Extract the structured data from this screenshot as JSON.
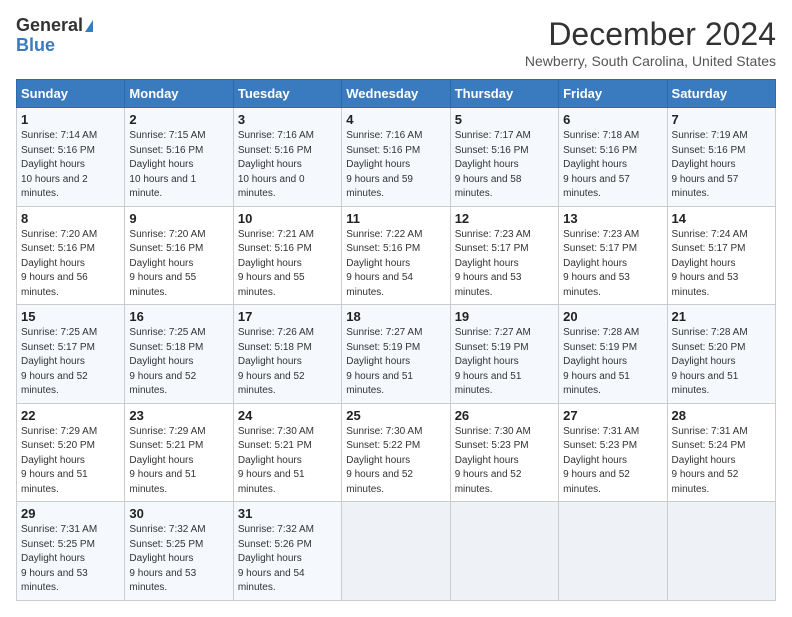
{
  "header": {
    "logo_general": "General",
    "logo_blue": "Blue",
    "month_title": "December 2024",
    "location": "Newberry, South Carolina, United States"
  },
  "weekdays": [
    "Sunday",
    "Monday",
    "Tuesday",
    "Wednesday",
    "Thursday",
    "Friday",
    "Saturday"
  ],
  "weeks": [
    [
      {
        "day": "1",
        "sunrise": "7:14 AM",
        "sunset": "5:16 PM",
        "daylight": "10 hours and 2 minutes."
      },
      {
        "day": "2",
        "sunrise": "7:15 AM",
        "sunset": "5:16 PM",
        "daylight": "10 hours and 1 minute."
      },
      {
        "day": "3",
        "sunrise": "7:16 AM",
        "sunset": "5:16 PM",
        "daylight": "10 hours and 0 minutes."
      },
      {
        "day": "4",
        "sunrise": "7:16 AM",
        "sunset": "5:16 PM",
        "daylight": "9 hours and 59 minutes."
      },
      {
        "day": "5",
        "sunrise": "7:17 AM",
        "sunset": "5:16 PM",
        "daylight": "9 hours and 58 minutes."
      },
      {
        "day": "6",
        "sunrise": "7:18 AM",
        "sunset": "5:16 PM",
        "daylight": "9 hours and 57 minutes."
      },
      {
        "day": "7",
        "sunrise": "7:19 AM",
        "sunset": "5:16 PM",
        "daylight": "9 hours and 57 minutes."
      }
    ],
    [
      {
        "day": "8",
        "sunrise": "7:20 AM",
        "sunset": "5:16 PM",
        "daylight": "9 hours and 56 minutes."
      },
      {
        "day": "9",
        "sunrise": "7:20 AM",
        "sunset": "5:16 PM",
        "daylight": "9 hours and 55 minutes."
      },
      {
        "day": "10",
        "sunrise": "7:21 AM",
        "sunset": "5:16 PM",
        "daylight": "9 hours and 55 minutes."
      },
      {
        "day": "11",
        "sunrise": "7:22 AM",
        "sunset": "5:16 PM",
        "daylight": "9 hours and 54 minutes."
      },
      {
        "day": "12",
        "sunrise": "7:23 AM",
        "sunset": "5:17 PM",
        "daylight": "9 hours and 53 minutes."
      },
      {
        "day": "13",
        "sunrise": "7:23 AM",
        "sunset": "5:17 PM",
        "daylight": "9 hours and 53 minutes."
      },
      {
        "day": "14",
        "sunrise": "7:24 AM",
        "sunset": "5:17 PM",
        "daylight": "9 hours and 53 minutes."
      }
    ],
    [
      {
        "day": "15",
        "sunrise": "7:25 AM",
        "sunset": "5:17 PM",
        "daylight": "9 hours and 52 minutes."
      },
      {
        "day": "16",
        "sunrise": "7:25 AM",
        "sunset": "5:18 PM",
        "daylight": "9 hours and 52 minutes."
      },
      {
        "day": "17",
        "sunrise": "7:26 AM",
        "sunset": "5:18 PM",
        "daylight": "9 hours and 52 minutes."
      },
      {
        "day": "18",
        "sunrise": "7:27 AM",
        "sunset": "5:19 PM",
        "daylight": "9 hours and 51 minutes."
      },
      {
        "day": "19",
        "sunrise": "7:27 AM",
        "sunset": "5:19 PM",
        "daylight": "9 hours and 51 minutes."
      },
      {
        "day": "20",
        "sunrise": "7:28 AM",
        "sunset": "5:19 PM",
        "daylight": "9 hours and 51 minutes."
      },
      {
        "day": "21",
        "sunrise": "7:28 AM",
        "sunset": "5:20 PM",
        "daylight": "9 hours and 51 minutes."
      }
    ],
    [
      {
        "day": "22",
        "sunrise": "7:29 AM",
        "sunset": "5:20 PM",
        "daylight": "9 hours and 51 minutes."
      },
      {
        "day": "23",
        "sunrise": "7:29 AM",
        "sunset": "5:21 PM",
        "daylight": "9 hours and 51 minutes."
      },
      {
        "day": "24",
        "sunrise": "7:30 AM",
        "sunset": "5:21 PM",
        "daylight": "9 hours and 51 minutes."
      },
      {
        "day": "25",
        "sunrise": "7:30 AM",
        "sunset": "5:22 PM",
        "daylight": "9 hours and 52 minutes."
      },
      {
        "day": "26",
        "sunrise": "7:30 AM",
        "sunset": "5:23 PM",
        "daylight": "9 hours and 52 minutes."
      },
      {
        "day": "27",
        "sunrise": "7:31 AM",
        "sunset": "5:23 PM",
        "daylight": "9 hours and 52 minutes."
      },
      {
        "day": "28",
        "sunrise": "7:31 AM",
        "sunset": "5:24 PM",
        "daylight": "9 hours and 52 minutes."
      }
    ],
    [
      {
        "day": "29",
        "sunrise": "7:31 AM",
        "sunset": "5:25 PM",
        "daylight": "9 hours and 53 minutes."
      },
      {
        "day": "30",
        "sunrise": "7:32 AM",
        "sunset": "5:25 PM",
        "daylight": "9 hours and 53 minutes."
      },
      {
        "day": "31",
        "sunrise": "7:32 AM",
        "sunset": "5:26 PM",
        "daylight": "9 hours and 54 minutes."
      },
      null,
      null,
      null,
      null
    ]
  ],
  "labels": {
    "sunrise": "Sunrise:",
    "sunset": "Sunset:",
    "daylight": "Daylight hours"
  }
}
